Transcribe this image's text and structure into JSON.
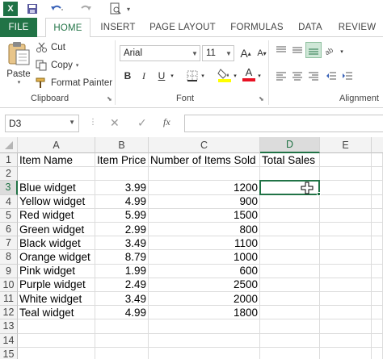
{
  "app": {
    "logo_letter": "X",
    "accent": "#217346"
  },
  "tabs": [
    "FILE",
    "HOME",
    "INSERT",
    "PAGE LAYOUT",
    "FORMULAS",
    "DATA",
    "REVIEW"
  ],
  "ribbon": {
    "clipboard": {
      "paste": "Paste",
      "cut": "Cut",
      "copy": "Copy",
      "format_painter": "Format Painter",
      "label": "Clipboard"
    },
    "font": {
      "name": "Arial",
      "size": "11",
      "bold": "B",
      "italic": "I",
      "underline": "U",
      "label": "Font",
      "font_color": "#e81123",
      "fill_color": "#ffff00"
    },
    "alignment": {
      "label": "Alignment"
    }
  },
  "formula_bar": {
    "name_box": "D3",
    "fx": "fx",
    "content": ""
  },
  "grid": {
    "columns": [
      "A",
      "B",
      "C",
      "D",
      "E"
    ],
    "rows": [
      "1",
      "2",
      "3",
      "4",
      "5",
      "6",
      "7",
      "8",
      "9",
      "10",
      "11",
      "12",
      "13",
      "14",
      "15"
    ],
    "header_row": [
      "Item Name",
      "Item Price",
      "Number of Items Sold",
      "Total Sales"
    ],
    "data": [
      [
        "Blue widget",
        "3.99",
        "1200"
      ],
      [
        "Yellow widget",
        "4.99",
        "900"
      ],
      [
        "Red widget",
        "5.99",
        "1500"
      ],
      [
        "Green widget",
        "2.99",
        "800"
      ],
      [
        "Black widget",
        "3.49",
        "1100"
      ],
      [
        "Orange widget",
        "8.79",
        "1000"
      ],
      [
        "Pink widget",
        "1.99",
        "600"
      ],
      [
        "Purple widget",
        "2.49",
        "2500"
      ],
      [
        "White widget",
        "3.49",
        "2000"
      ],
      [
        "Teal widget",
        "4.99",
        "1800"
      ]
    ],
    "selected_cell": "D3"
  }
}
